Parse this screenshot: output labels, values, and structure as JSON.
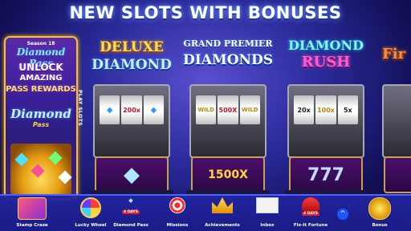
{
  "headline": {
    "part1": "NEW SLOTS ",
    "part2": "WITH BONUSES"
  },
  "promo": {
    "season": "Season 18",
    "logo": "Diamond Pass",
    "line1": "UNLOCK",
    "line2": "AMAZING",
    "line3": "PASS REWARDS",
    "diamond": "Diamond",
    "pass": "Pass"
  },
  "play_slots": "PLAY SLOTS",
  "machines": [
    {
      "title1": "DELUXE",
      "title2": "DIAMOND",
      "reels": [
        "◆",
        "200x",
        "◆"
      ],
      "panel": "◆"
    },
    {
      "title1": "GRAND PREMIER",
      "title2": "DIAMONDS",
      "reels": [
        "WILD",
        "500X",
        "WILD"
      ],
      "panel": "1500X"
    },
    {
      "title1": "DIAMOND",
      "title2": "RUSH",
      "reels": [
        "20x",
        "100x",
        "5x"
      ],
      "panel": "777"
    },
    {
      "title1": "Fir",
      "title2": "",
      "reels": [
        "",
        "",
        ""
      ],
      "panel": ""
    }
  ],
  "bottom_bar": {
    "stamp": "Stamp Craze",
    "lucky_wheel": "Lucky Wheel",
    "diamond_pass": "Diamond Pass",
    "diamond_pass_badge": "4 DAYS",
    "missions": "Missions",
    "achievements": "Achievements",
    "inbox": "Inbox",
    "fixit": "Fix-It Fortune",
    "fixit_badge": "4 DAYS",
    "bonus": "Bonus",
    "chevron": "^"
  },
  "colors": {
    "accent": "#f7c13a",
    "bar": "#1a1c86",
    "badge": "#e31d2b"
  }
}
